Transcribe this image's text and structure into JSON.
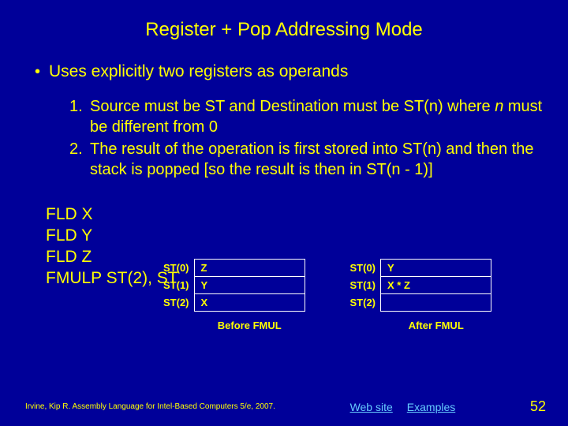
{
  "title": "Register + Pop Addressing Mode",
  "bullet": "Uses explicitly two registers as operands",
  "numbered": [
    {
      "n": "1.",
      "text_before": "Source must be ST and Destination must be ST(n) where ",
      "italic": "n",
      "text_after": " must be different from 0"
    },
    {
      "n": "2.",
      "text_before": "The result of the operation is first stored into ST(n) and then the stack is popped [so the result is then in ST(n - 1)]",
      "italic": "",
      "text_after": ""
    }
  ],
  "code": {
    "l1": "FLD X",
    "l2": "FLD Y",
    "l3": "FLD Z",
    "l4": "FMULP ST(2), ST"
  },
  "before": {
    "caption": "Before FMUL",
    "rows": [
      {
        "reg": "ST(0)",
        "val": "Z"
      },
      {
        "reg": "ST(1)",
        "val": "Y"
      },
      {
        "reg": "ST(2)",
        "val": "X"
      }
    ]
  },
  "after": {
    "caption": "After FMUL",
    "rows": [
      {
        "reg": "ST(0)",
        "val": "Y"
      },
      {
        "reg": "ST(1)",
        "val": "X * Z"
      },
      {
        "reg": "ST(2)",
        "val": ""
      }
    ]
  },
  "footer": {
    "citation": "Irvine, Kip R. Assembly Language for Intel-Based Computers 5/e, 2007.",
    "link1": "Web site",
    "link2": "Examples",
    "page": "52"
  }
}
